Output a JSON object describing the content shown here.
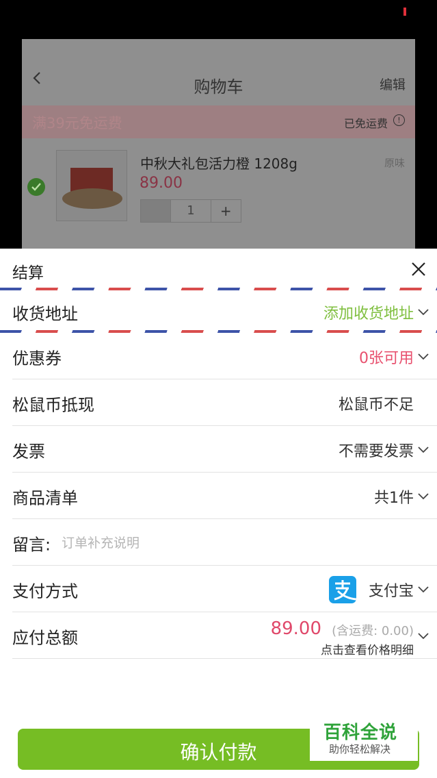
{
  "background_cart": {
    "title": "购物车",
    "edit_label": "编辑",
    "banner_text": "满39元免运费",
    "free_shipping_label": "已免运费",
    "item": {
      "name": "中秋大礼包活力橙 1208g",
      "flavor": "原味",
      "price": "89.00",
      "quantity": "1",
      "plus_label": "+"
    }
  },
  "checkout": {
    "title": "结算",
    "rows": [
      {
        "label": "收货地址",
        "value": "添加收货地址"
      },
      {
        "label": "优惠券",
        "value": "0张可用"
      },
      {
        "label": "松鼠币抵现",
        "value": "松鼠币不足"
      },
      {
        "label": "发票",
        "value": "不需要发票"
      },
      {
        "label": "商品清单",
        "value": "共1件"
      }
    ],
    "message": {
      "label": "留言:",
      "placeholder": "订单补充说明"
    },
    "payment": {
      "label": "支付方式",
      "value": "支付宝"
    },
    "total": {
      "label": "应付总额",
      "amount": "89.00",
      "shipping_note": "(含运费: 0.00)",
      "detail_link": "点击查看价格明细"
    },
    "confirm_label": "确认付款"
  },
  "watermark": {
    "title": "百科全说",
    "subtitle": "助你轻松解决"
  },
  "colors": {
    "accent_green": "#76bd24",
    "price_pink": "#e0486a",
    "alipay_blue": "#1aa0e8"
  }
}
